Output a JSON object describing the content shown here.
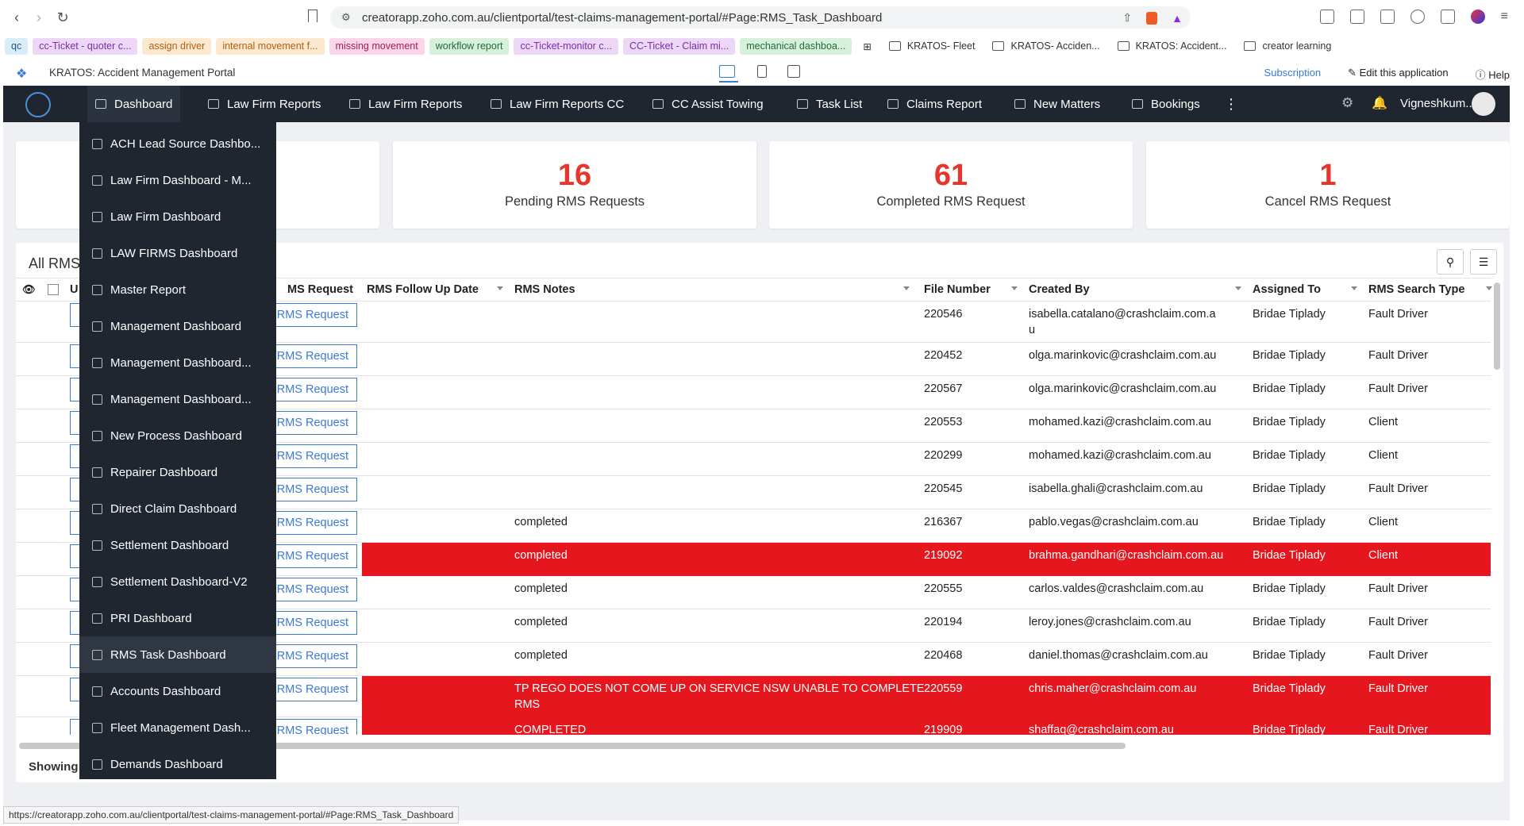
{
  "browser": {
    "url": "creatorapp.zoho.com.au/clientportal/test-claims-management-portal/#Page:RMS_Task_Dashboard",
    "status_url": "https://creatorapp.zoho.com.au/clientportal/test-claims-management-portal/#Page:RMS_Task_Dashboard"
  },
  "bookmarks": [
    {
      "label": "qc",
      "bg": "#d9ecf7",
      "color": "#1a5a8a"
    },
    {
      "label": "cc-Ticket - quoter c...",
      "bg": "#ecd8f6",
      "color": "#7a2ea8"
    },
    {
      "label": "assign driver",
      "bg": "#fde7cf",
      "color": "#b05f10"
    },
    {
      "label": "internal movement f...",
      "bg": "#fde7cf",
      "color": "#b05f10"
    },
    {
      "label": "missing movement",
      "bg": "#fbd5e8",
      "color": "#a0215a"
    },
    {
      "label": "workflow report",
      "bg": "#d7f0dc",
      "color": "#226b31"
    },
    {
      "label": "cc-Ticket-monitor c...",
      "bg": "#ecd8f6",
      "color": "#7a2ea8"
    },
    {
      "label": "CC-Ticket - Claim mi...",
      "bg": "#ecd8f6",
      "color": "#7a2ea8"
    },
    {
      "label": "mechanical dashboa...",
      "bg": "#d7f0dc",
      "color": "#226b31"
    }
  ],
  "bookmark_folders": [
    "KRATOS- Fleet",
    "KRATOS- Acciden...",
    "KRATOS: Accident...",
    "creator learning"
  ],
  "app": {
    "title": "KRATOS: Accident Management Portal",
    "subscription": "Subscription",
    "edit": "Edit this application",
    "help": "Help"
  },
  "nav": {
    "items": [
      "Dashboard",
      "Law Firm Reports",
      "Law Firm Reports",
      "Law Firm Reports CC",
      "CC Assist Towing",
      "Task List",
      "Claims Report",
      "New Matters",
      "Bookings"
    ],
    "user": "Vigneshkum..."
  },
  "dropdown": [
    "ACH Lead Source Dashbo...",
    "Law Firm Dashboard - M...",
    "Law Firm Dashboard",
    "LAW FIRMS Dashboard",
    "Master Report",
    "Management Dashboard",
    "Management Dashboard...",
    "Management Dashboard...",
    "New Process Dashboard",
    "Repairer Dashboard",
    "Direct Claim Dashboard",
    "Settlement Dashboard",
    "Settlement Dashboard-V2",
    "PRI Dashboard",
    "RMS Task Dashboard",
    "Accounts Dashboard",
    "Fleet Management Dash...",
    "Demands Dashboard"
  ],
  "dropdown_active": "RMS Task Dashboard",
  "cards": [
    {
      "value": "16",
      "label": "Pending RMS Requests"
    },
    {
      "value": "61",
      "label": "Completed RMS Request"
    },
    {
      "value": "1",
      "label": "Cancel RMS Request"
    }
  ],
  "table": {
    "title": "All RMS",
    "headers": [
      "U",
      "MS Request",
      "RMS Follow Up Date",
      "RMS Notes",
      "File Number",
      "Created By",
      "Assigned To",
      "RMS Search Type"
    ],
    "button_label": "RMS Request",
    "rows": [
      {
        "notes": "",
        "file": "220546",
        "created": "isabella.catalano@crashclaim.com.a",
        "created2": "u",
        "assigned": "Bridae Tiplady",
        "type": "Fault Driver",
        "red": false
      },
      {
        "notes": "",
        "file": "220452",
        "created": "olga.marinkovic@crashclaim.com.au",
        "created2": "",
        "assigned": "Bridae Tiplady",
        "type": "Fault Driver",
        "red": false
      },
      {
        "notes": "",
        "file": "220567",
        "created": "olga.marinkovic@crashclaim.com.au",
        "created2": "",
        "assigned": "Bridae Tiplady",
        "type": "Fault Driver",
        "red": false
      },
      {
        "notes": "",
        "file": "220553",
        "created": "mohamed.kazi@crashclaim.com.au",
        "created2": "",
        "assigned": "Bridae Tiplady",
        "type": "Client",
        "red": false
      },
      {
        "notes": "",
        "file": "220299",
        "created": "mohamed.kazi@crashclaim.com.au",
        "created2": "",
        "assigned": "Bridae Tiplady",
        "type": "Client",
        "red": false
      },
      {
        "notes": "",
        "file": "220545",
        "created": "isabella.ghali@crashclaim.com.au",
        "created2": "",
        "assigned": "Bridae Tiplady",
        "type": "Fault Driver",
        "red": false
      },
      {
        "notes": "completed",
        "file": "216367",
        "created": "pablo.vegas@crashclaim.com.au",
        "created2": "",
        "assigned": "Bridae Tiplady",
        "type": "Client",
        "red": false
      },
      {
        "notes": "completed",
        "file": "219092",
        "created": "brahma.gandhari@crashclaim.com.au",
        "created2": "",
        "assigned": "Bridae Tiplady",
        "type": "Client",
        "red": true
      },
      {
        "notes": "completed",
        "file": "220555",
        "created": "carlos.valdes@crashclaim.com.au",
        "created2": "",
        "assigned": "Bridae Tiplady",
        "type": "Fault Driver",
        "red": false
      },
      {
        "notes": "completed",
        "file": "220194",
        "created": "leroy.jones@crashclaim.com.au",
        "created2": "",
        "assigned": "Bridae Tiplady",
        "type": "Fault Driver",
        "red": false
      },
      {
        "notes": "completed",
        "file": "220468",
        "created": "daniel.thomas@crashclaim.com.au",
        "created2": "",
        "assigned": "Bridae Tiplady",
        "type": "Fault Driver",
        "red": false
      },
      {
        "notes": "TP REGO DOES NOT COME UP ON SERVICE NSW UNABLE TO COMPLETE",
        "notes2": "RMS",
        "file": "220559",
        "created": "chris.maher@crashclaim.com.au",
        "created2": "",
        "assigned": "Bridae Tiplady",
        "type": "Fault Driver",
        "red": true
      },
      {
        "notes": "COMPLETED",
        "file": "219909",
        "created": "shaffaq@crashclaim.com.au",
        "created2": "",
        "assigned": "Bridae Tiplady",
        "type": "Fault Driver",
        "red": true
      }
    ],
    "showing": "Showing"
  },
  "colors": {
    "navbar": "#1f2630",
    "alert_red": "#e5161d",
    "count_red": "#e8352b",
    "link_blue": "#3a7bd5"
  }
}
